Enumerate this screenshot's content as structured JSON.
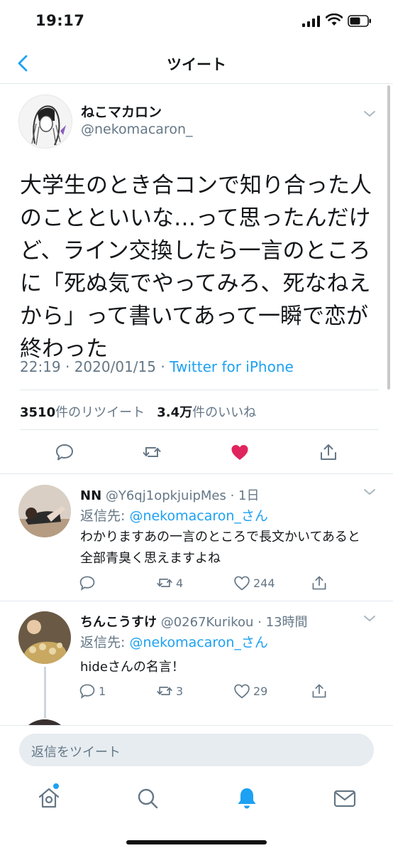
{
  "status_bar": {
    "time": "19:17"
  },
  "nav": {
    "title": "ツイート"
  },
  "tweet": {
    "name": "ねこマカロン",
    "handle": "@nekomacaron_",
    "text": "大学生のとき合コンで知り合った人のことといいな…って思ったんだけど、ライン交換したら一言のところに「死ぬ気でやってみろ、死なねえから」って書いてあって一瞬で恋が終わった",
    "time": "22:19 · 2020/01/15 · ",
    "source": "Twitter for iPhone",
    "retweets_count": "3510",
    "retweets_label": "件のリツイート",
    "likes_count": "3.4万",
    "likes_label": "件のいいね",
    "liked": true
  },
  "replies": [
    {
      "name": "NN",
      "handle_time": " @Y6qj1opkjuipMes · 1日",
      "reply_prefix": "返信先: ",
      "reply_to": "@nekomacaron_さん",
      "text": "わかりますあの一言のところで長文かいてあると全部青臭く思えますよね",
      "reply_count": "",
      "retweet_count": "4",
      "like_count": "244"
    },
    {
      "name": "ちんこうすけ",
      "handle_time": " @0267Kurikou · 13時間",
      "reply_prefix": "返信先: ",
      "reply_to": "@nekomacaron_さん",
      "text": "hideさんの名言！",
      "reply_count": "1",
      "retweet_count": "3",
      "like_count": "29"
    }
  ],
  "composer": {
    "placeholder": "返信をツイート"
  },
  "tabs": [
    "home-icon",
    "search-icon",
    "notifications-icon",
    "messages-icon"
  ],
  "colors": {
    "accent": "#1da1f2",
    "like": "#e0245e",
    "secondary_text": "#657786"
  }
}
